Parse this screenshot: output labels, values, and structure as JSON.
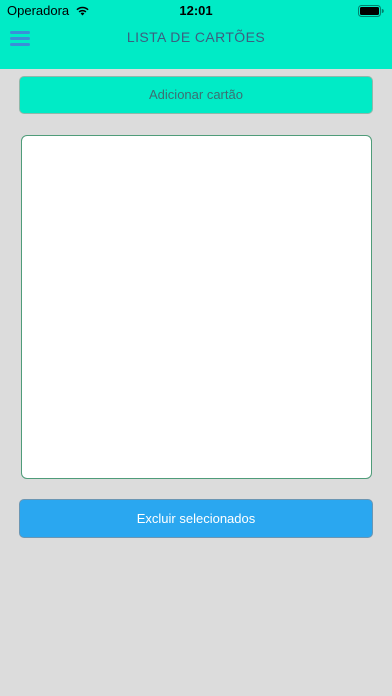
{
  "status_bar": {
    "carrier": "Operadora",
    "time": "12:01",
    "wifi_icon": "wifi-icon",
    "battery_icon": "battery-icon"
  },
  "nav_bar": {
    "menu_icon": "hamburger-menu-icon",
    "title": "LISTA DE CARTÕES"
  },
  "actions": {
    "add_label": "Adicionar cartão",
    "delete_label": "Excluir selecionados"
  },
  "card_list": {
    "items": []
  },
  "colors": {
    "accent": "#00ebc6",
    "primary_button": "#2aa7f0",
    "background": "#dcdcdc",
    "list_border": "#4f9c79"
  }
}
